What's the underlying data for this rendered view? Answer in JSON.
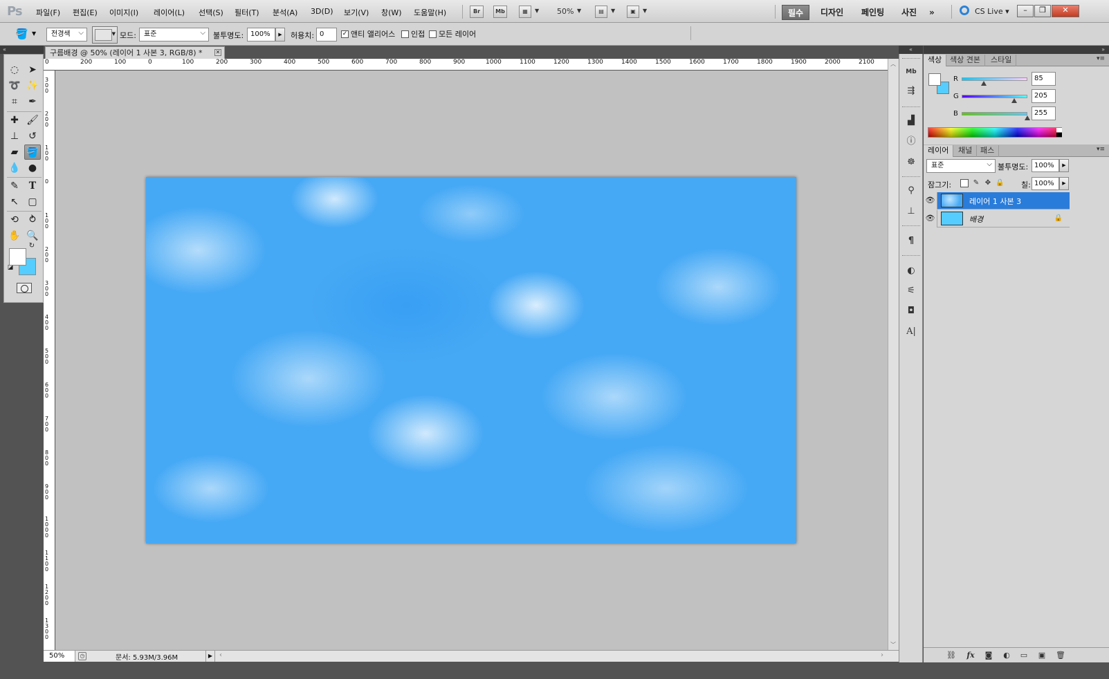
{
  "app": {
    "logo": "Ps"
  },
  "menu": [
    "파일(F)",
    "편집(E)",
    "이미지(I)",
    "레이어(L)",
    "선택(S)",
    "필터(T)",
    "분석(A)",
    "3D(D)",
    "보기(V)",
    "창(W)",
    "도움말(H)"
  ],
  "menubar_tools": {
    "bridge": "Br",
    "minibridge": "Mb",
    "zoom": "50%"
  },
  "workspaces": [
    "필수",
    "디자인",
    "페인팅",
    "사진"
  ],
  "workspace_more": "»",
  "cs_live": "CS Live",
  "window_controls": {
    "minimize": "–",
    "restore": "❐",
    "close": "✕"
  },
  "options": {
    "fill_source": "전경색",
    "mode_label": "모드:",
    "mode_value": "표준",
    "opacity_label": "불투명도:",
    "opacity_value": "100%",
    "tolerance_label": "허용치:",
    "tolerance_value": "0",
    "antialias_label": "앤티 앨리어스",
    "antialias_checked": "✓",
    "contiguous_label": "인접",
    "all_layers_label": "모든 레이어"
  },
  "collapse": {
    "left": "«",
    "right": "«",
    "panel": "»"
  },
  "document": {
    "tab_title": "구름배경 @ 50% (레이어 1 사본 3, RGB/8) *",
    "tab_close": "✕",
    "ruler_h": [
      "0",
      "200",
      "100",
      "0",
      "100",
      "200",
      "300",
      "400",
      "500",
      "600",
      "700",
      "800",
      "900",
      "1000",
      "1100",
      "1200",
      "1300",
      "1400",
      "1500",
      "1600",
      "1700",
      "1800",
      "1900",
      "2000",
      "2100"
    ],
    "ruler_v": [
      "300",
      "200",
      "100",
      "0",
      "100",
      "200",
      "300",
      "400",
      "500",
      "600",
      "700",
      "800",
      "900",
      "1000",
      "1100",
      "1200",
      "1300"
    ]
  },
  "status": {
    "zoom": "50%",
    "doc_info": "문서: 5.93M/3.96M",
    "menu_arrow": "▶"
  },
  "color_panel": {
    "tabs": [
      "색상",
      "색상 견본",
      "스타일"
    ],
    "menu": "▾≡",
    "r_label": "R",
    "g_label": "G",
    "b_label": "B",
    "r": "85",
    "g": "205",
    "b": "255",
    "r_fraction": 0.333,
    "g_fraction": 0.804,
    "b_fraction": 1.0,
    "foreground": "#ffffff",
    "background": "#55cdff"
  },
  "layers_panel": {
    "tabs": [
      "레이어",
      "채널",
      "패스"
    ],
    "menu": "▾≡",
    "blend_mode": "표준",
    "opacity_label": "불투명도:",
    "opacity": "100%",
    "lock_label": "잠그기:",
    "fill_label": "칠:",
    "fill": "100%",
    "layers": [
      {
        "name": "레이어 1 사본 3",
        "visible": "👁",
        "selected": true
      },
      {
        "name": "배경",
        "visible": "👁",
        "locked": "🔒"
      }
    ],
    "footer_icons": [
      "link-icon",
      "fx-icon",
      "mask-icon",
      "adjustment-icon",
      "group-icon",
      "new-layer-icon",
      "trash-icon"
    ],
    "footer_glyphs": [
      "⛓",
      "fx",
      "◙",
      "◐",
      "▭",
      "▣",
      "🗑"
    ]
  },
  "tools": {
    "fg_color": "#ffffff",
    "bg_color": "#55cdff"
  },
  "colors": {
    "selected": "#2a7cda",
    "canvas_bg": "#c1c1c1",
    "sky": "#46a9f5"
  }
}
